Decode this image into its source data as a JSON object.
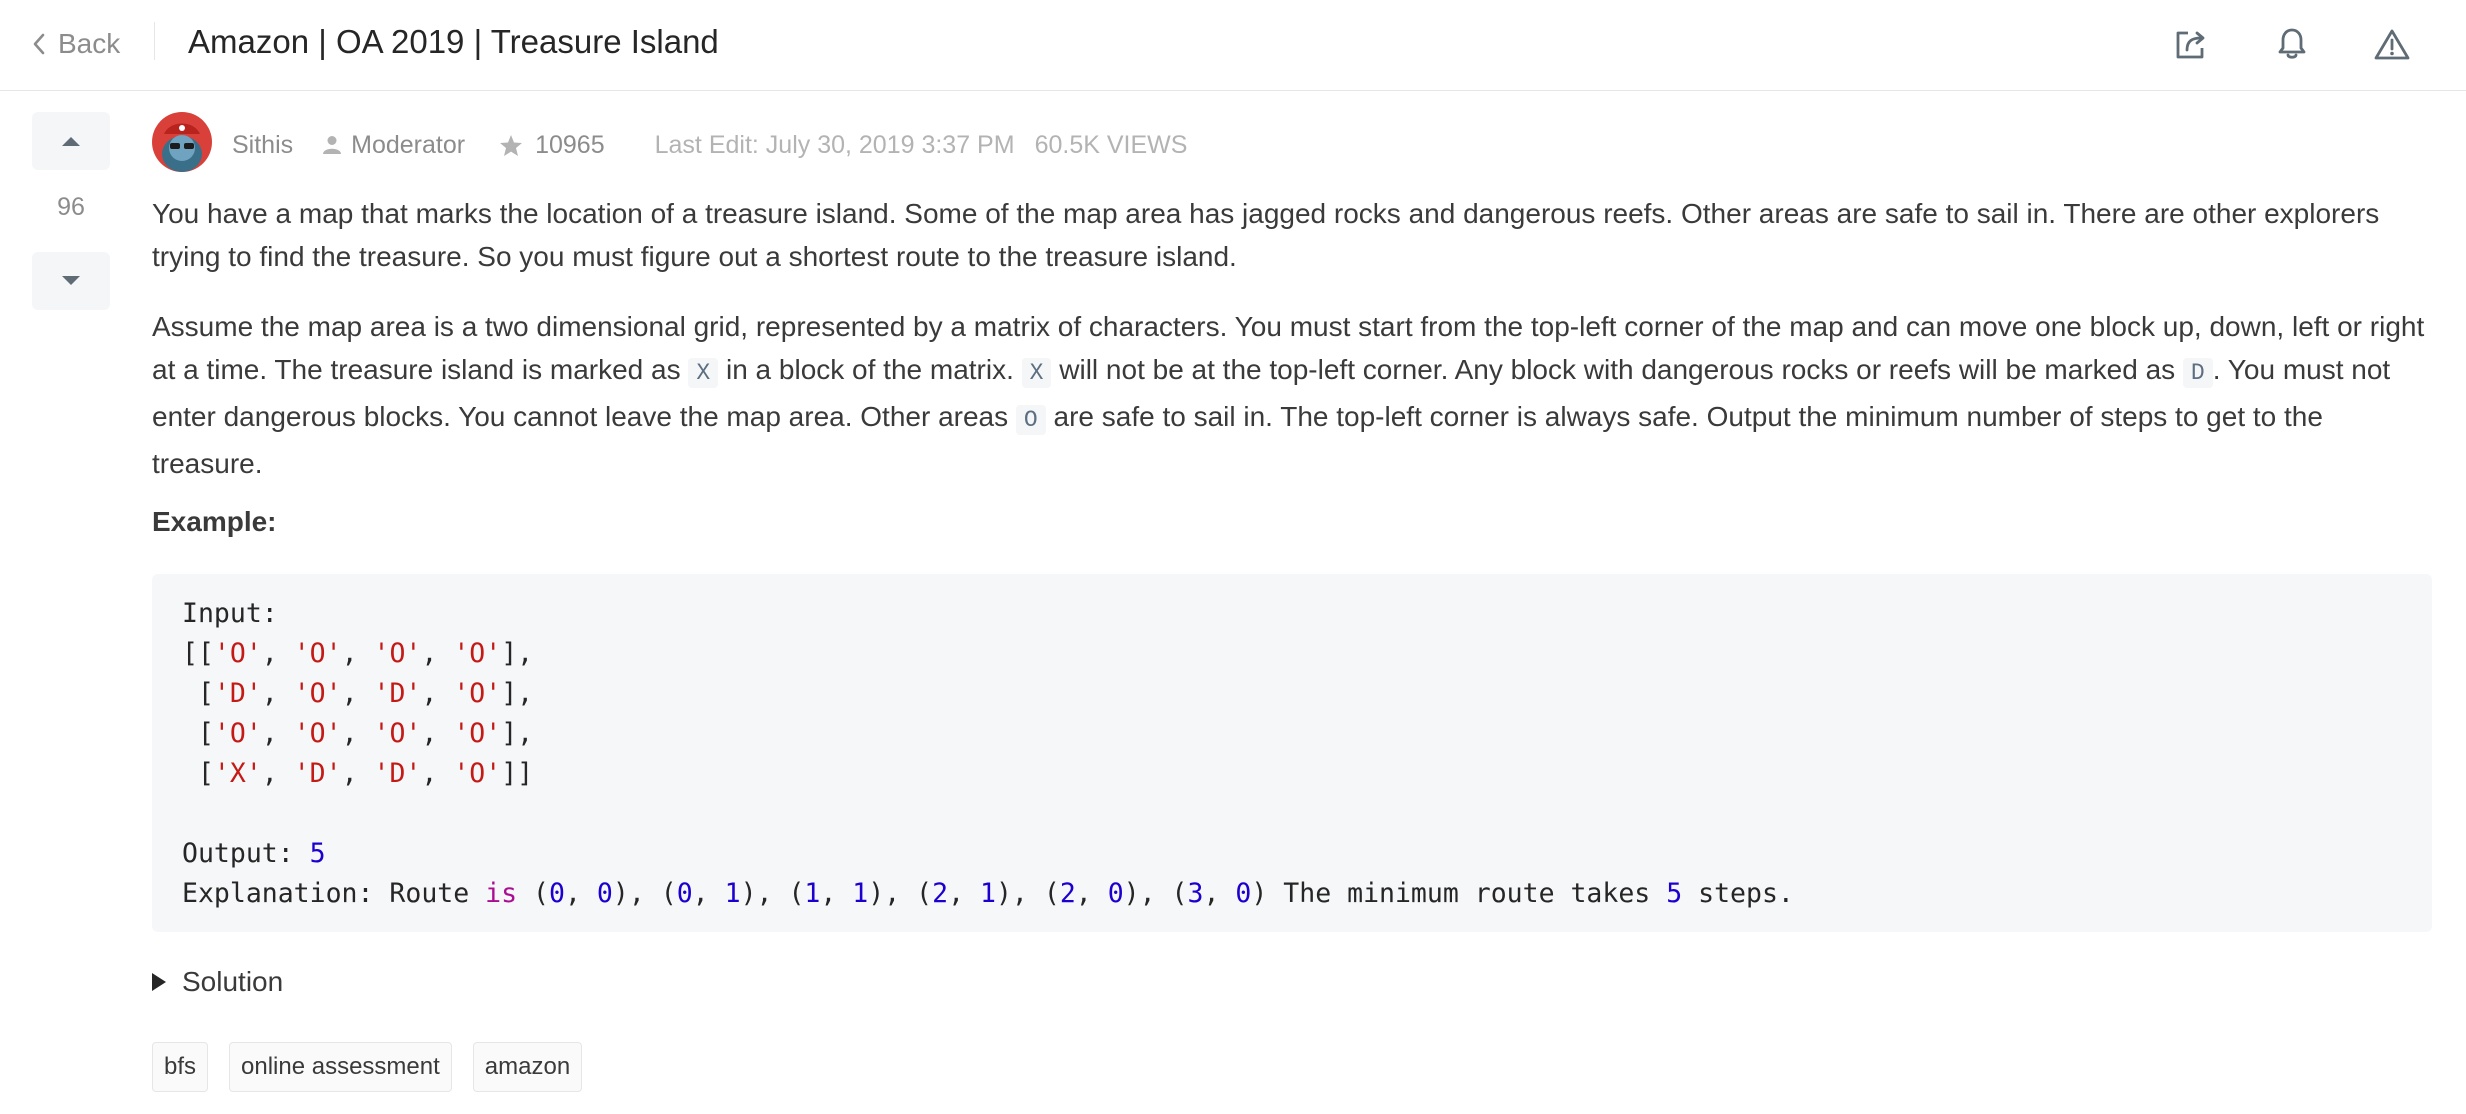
{
  "header": {
    "back_label": "Back",
    "title": "Amazon | OA 2019 | Treasure Island",
    "icons": [
      "share-icon",
      "bell-icon",
      "warning-icon"
    ]
  },
  "vote": {
    "count": "96"
  },
  "post": {
    "author": "Sithis",
    "role": "Moderator",
    "reputation": "10965",
    "last_edit": "Last Edit: July 30, 2019 3:37 PM",
    "views": "60.5K VIEWS"
  },
  "body": {
    "p1": "You have a map that marks the location of a treasure island. Some of the map area has jagged rocks and dangerous reefs. Other areas are safe to sail in. There are other explorers trying to find the treasure. So you must figure out a shortest route to the treasure island.",
    "p2_a": "Assume the map area is a two dimensional grid, represented by a matrix of characters. You must start from the top-left corner of the map and can move one block up, down, left or right at a time. The treasure island is marked as ",
    "code_x1": "X",
    "p2_b": " in a block of the matrix. ",
    "code_x2": "X",
    "p2_c": " will not be at the top-left corner. Any block with dangerous rocks or reefs will be marked as ",
    "code_d": "D",
    "p2_d": ". You must not enter dangerous blocks. You cannot leave the map area. Other areas ",
    "code_o": "O",
    "p2_e": " are safe to sail in. The top-left corner is always safe. Output the minimum number of steps to get to the treasure.",
    "example_label": "Example:"
  },
  "example": {
    "input_label": "Input:",
    "grid": [
      [
        "O",
        "O",
        "O",
        "O"
      ],
      [
        "D",
        "O",
        "D",
        "O"
      ],
      [
        "O",
        "O",
        "O",
        "O"
      ],
      [
        "X",
        "D",
        "D",
        "O"
      ]
    ],
    "output_label": "Output:",
    "output_value": "5",
    "explanation_label": "Explanation: Route",
    "explanation_keyword": "is",
    "route": [
      [
        0,
        0
      ],
      [
        0,
        1
      ],
      [
        1,
        1
      ],
      [
        2,
        1
      ],
      [
        2,
        0
      ],
      [
        3,
        0
      ]
    ],
    "explanation_tail_a": "The minimum route takes",
    "explanation_steps": "5",
    "explanation_tail_b": "steps."
  },
  "solution_label": "Solution",
  "tags": [
    "bfs",
    "online assessment",
    "amazon"
  ]
}
